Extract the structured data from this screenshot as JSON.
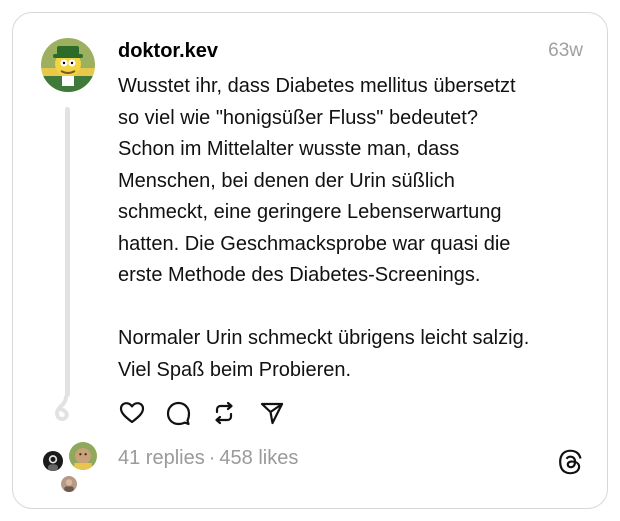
{
  "post": {
    "username": "doktor.kev",
    "time_ago": "63w",
    "paragraph1": [
      "Wusstet ihr, dass Diabetes mellitus übersetzt",
      "so viel wie \"honigsüßer Fluss\" bedeutet?",
      "Schon im Mittelalter wusste man, dass",
      "Menschen, bei denen der Urin süßlich",
      "schmeckt, eine geringere Lebenserwartung",
      "hatten. Die Geschmacksprobe war quasi die",
      "erste Methode des Diabetes-Screenings."
    ],
    "paragraph2": [
      "Normaler Urin schmeckt übrigens leicht salzig.",
      "Viel Spaß beim Probieren."
    ]
  },
  "stats": {
    "replies": "41 replies",
    "separator": "·",
    "likes": "458 likes"
  },
  "icons": {
    "like": "heart-icon",
    "reply": "comment-icon",
    "repost": "repost-icon",
    "share": "send-icon",
    "brand": "threads-logo-icon"
  },
  "colors": {
    "text": "#111111",
    "muted": "#9a9a9a",
    "border": "#d8d8d8",
    "thread_line": "#e2e2e2"
  }
}
